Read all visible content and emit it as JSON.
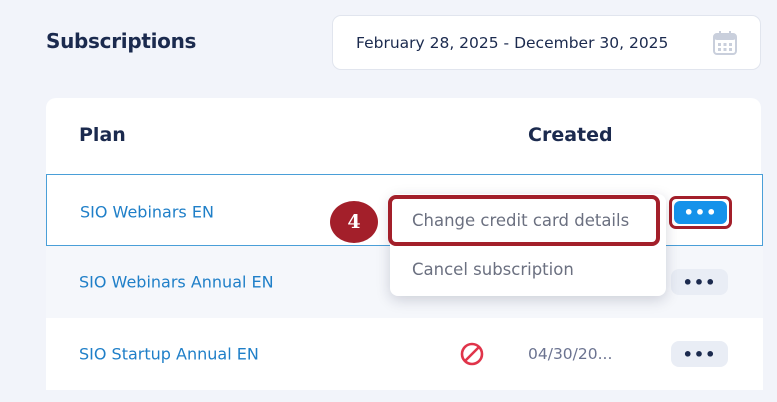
{
  "header": {
    "title": "Subscriptions",
    "date_range": "February 28, 2025 - December 30, 2025",
    "calendar_icon": "calendar-icon"
  },
  "table": {
    "columns": [
      "Plan",
      "Created"
    ],
    "rows": [
      {
        "plan": "SIO Webinars EN",
        "created": "",
        "status_icon": "",
        "more_label": "•••"
      },
      {
        "plan": "SIO Webinars Annual EN",
        "created": "",
        "status_icon": "",
        "more_label": "•••"
      },
      {
        "plan": "SIO Startup Annual EN",
        "created": "04/30/20...",
        "status_icon": "cancelled-icon",
        "more_label": "•••"
      }
    ]
  },
  "dropdown": {
    "items": [
      "Change credit card details",
      "Cancel subscription"
    ]
  },
  "annotation": {
    "step": "4"
  },
  "colors": {
    "accent": "#1592ea",
    "link": "#1f7fc8",
    "highlight": "#a31f2a",
    "cancel_status": "#e0344a"
  }
}
